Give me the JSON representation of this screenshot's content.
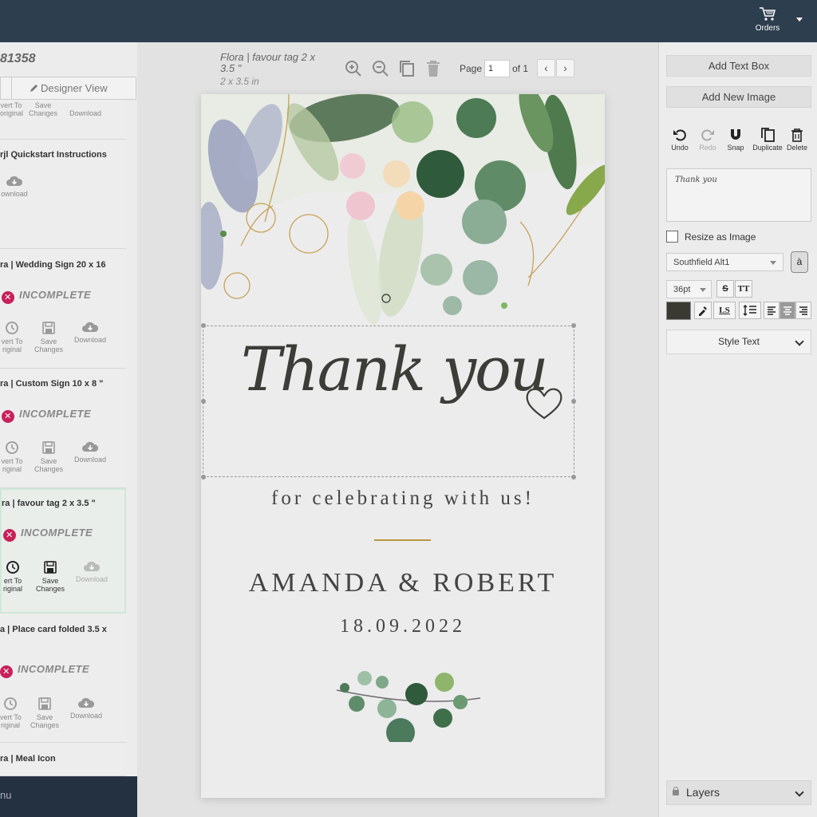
{
  "topbar": {
    "orders_label": "Orders"
  },
  "left": {
    "order_number": "81358",
    "designer_view": "Designer View",
    "cards": [
      {
        "title": "",
        "status": "",
        "actions": [
          "vert To\noriginal",
          "Save\nChanges",
          "Download"
        ]
      },
      {
        "title": "rjl Quickstart Instructions",
        "status": "",
        "actions": [
          "ownload"
        ]
      },
      {
        "title": "ra | Wedding Sign 20 x 16",
        "status": "INCOMPLETE",
        "actions": [
          "vert To\nriginal",
          "Save\nChanges",
          "Download"
        ]
      },
      {
        "title": "ra | Custom Sign 10 x 8 \"",
        "status": "INCOMPLETE",
        "actions": [
          "vert To\nriginal",
          "Save\nChanges",
          "Download"
        ]
      },
      {
        "title": "ra | favour tag 2 x 3.5 \"",
        "status": "INCOMPLETE",
        "actions": [
          "ert To\nriginal",
          "Save\nChanges",
          "Download"
        ]
      },
      {
        "title": "a | Place card folded 3.5 x",
        "status": "INCOMPLETE",
        "actions": [
          "vert To\nriginal",
          "Save\nChanges",
          "Download"
        ]
      },
      {
        "title": "ra | Meal Icon",
        "status": "",
        "actions": []
      }
    ],
    "menu_label": "nu"
  },
  "workspace": {
    "doc_title": "Flora | favour tag 2 x 3.5 \"",
    "doc_size": "2 x 3.5 in",
    "page_label": "Page",
    "page_value": "1",
    "page_of": "of 1",
    "prev": "‹",
    "next": "›"
  },
  "card": {
    "thank_you": "Thank you",
    "celebrate": "for  celebrating with us!",
    "names": "AMANDA & ROBERT",
    "date": "18.09.2022"
  },
  "right": {
    "add_text_box": "Add Text Box",
    "add_new_image": "Add New Image",
    "actions": {
      "undo": "Undo",
      "redo": "Redo",
      "snap": "Snap",
      "duplicate": "Duplicate",
      "delete": "Delete"
    },
    "preview_text": "Thank you",
    "resize_as_image": "Resize as Image",
    "font_family": "Southfield Alt1",
    "font_icon": "à",
    "font_size": "36pt",
    "strike": "S",
    "tt": "TT",
    "ls": "LS",
    "text_color": "#3a3a33",
    "style_text": "Style Text",
    "layers": "Layers"
  },
  "colors": {
    "topbar": "#2d3e4f",
    "incomplete": "#c8205a",
    "gold": "#b8963e"
  }
}
